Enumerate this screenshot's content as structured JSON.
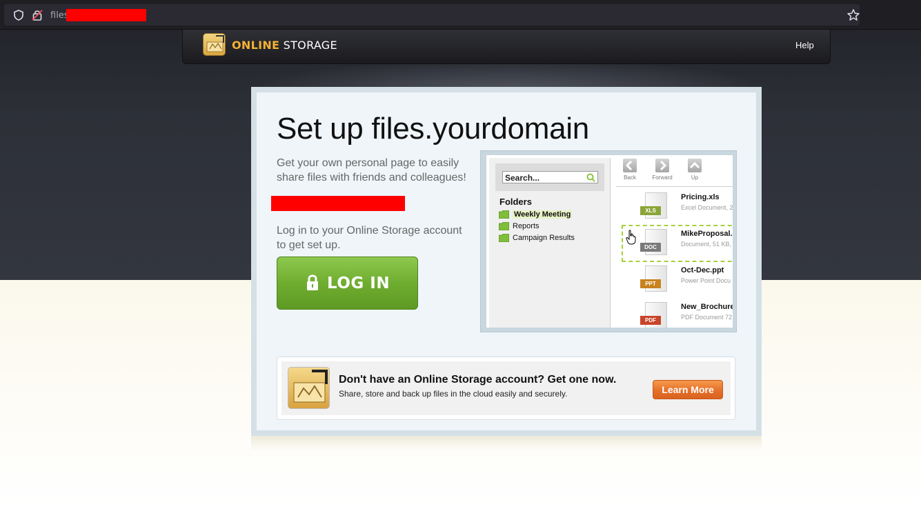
{
  "browser": {
    "url_text": "files",
    "icons": [
      "shield-icon",
      "lock-warning-icon",
      "star-icon"
    ]
  },
  "header": {
    "brand_part1": "ONLINE",
    "brand_part2": "STORAGE",
    "help_label": "Help"
  },
  "main": {
    "title": "Set up files.yourdomain",
    "intro": "Get your own personal page to easily share files with friends and colleagues!",
    "login_prompt": "Log in to your Online Storage account to get set up.",
    "login_button_label": "LOG IN"
  },
  "preview": {
    "search_placeholder": "Search...",
    "folders_heading": "Folders",
    "folders": [
      {
        "label": "Weekly Meeting",
        "active": true
      },
      {
        "label": "Reports",
        "active": false
      },
      {
        "label": "Campaign Results",
        "active": false
      }
    ],
    "nav": [
      {
        "label": "Back",
        "icon": "chevron-left-icon"
      },
      {
        "label": "Forward",
        "icon": "chevron-right-icon"
      },
      {
        "label": "Up",
        "icon": "chevron-up-icon"
      }
    ],
    "files": [
      {
        "name": "Pricing.xls",
        "meta": "Excel Document, 2",
        "badge": "XLS",
        "badge_color": "#8aa63a"
      },
      {
        "name": "MikeProposal.d",
        "meta": "Document, 51 KB,",
        "badge": "DOC",
        "badge_color": "#7a7a7a"
      },
      {
        "name": "Oct-Dec.ppt",
        "meta": "Power Point Docu",
        "badge": "PPT",
        "badge_color": "#c9821f"
      },
      {
        "name": "New_Brochure.",
        "meta": "PDF Document 72",
        "badge": "PDF",
        "badge_color": "#c8442a"
      }
    ]
  },
  "promo": {
    "title": "Don't have an Online Storage account? Get one now.",
    "subtitle": "Share, store and back up files in the cloud easily and securely.",
    "button_label": "Learn More"
  },
  "colors": {
    "brand_accent": "#f3b233",
    "login_green": "#6fad30",
    "learn_more_orange": "#e5702a",
    "redaction": "#ff0000"
  }
}
